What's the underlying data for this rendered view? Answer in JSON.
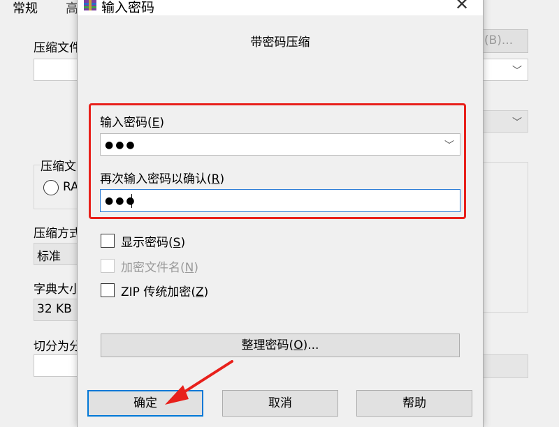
{
  "background_dialog": {
    "tab_label": "常规",
    "tab_label2": "高",
    "archive_name_label": "压缩文件",
    "browse_button": "(B)...",
    "format_group_label": "压缩文",
    "radio_label": "RA",
    "method_label": "压缩方式",
    "method_value": "标准",
    "dict_label": "字典大小",
    "dict_value": "32 KB",
    "split_label": "切分为分卷"
  },
  "dialog": {
    "title": "输入密码",
    "subtitle": "带密码压缩",
    "close_icon": "✕",
    "enter_password": {
      "label_text": "输入密码(",
      "label_mnemonic": "E",
      "label_end": ")",
      "value_masked": "●●●"
    },
    "confirm_password": {
      "label_text": "再次输入密码以确认(",
      "label_mnemonic": "R",
      "label_end": ")",
      "value_masked": "●●●"
    },
    "show_password": {
      "text": "显示密码(",
      "mnemonic": "S",
      "end": ")",
      "checked": false
    },
    "encrypt_names": {
      "text": "加密文件名(",
      "mnemonic": "N",
      "end": ")",
      "checked": false,
      "disabled": true
    },
    "zip_legacy": {
      "text": "ZIP 传统加密(",
      "mnemonic": "Z",
      "end": ")",
      "checked": false
    },
    "organize_button": {
      "text": "整理密码(",
      "mnemonic": "O",
      "end": ")..."
    },
    "ok_button": "确定",
    "cancel_button": "取消",
    "help_button": "帮助"
  },
  "colors": {
    "highlight_red": "#e8201b",
    "focus_blue": "#0078d7"
  }
}
